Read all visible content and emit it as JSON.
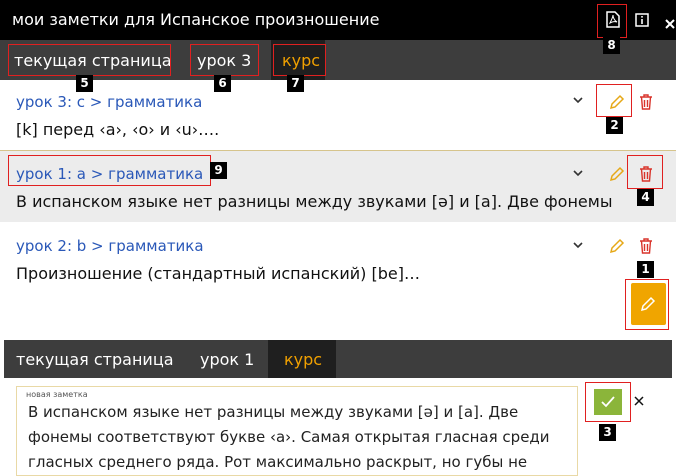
{
  "window": {
    "title": "мои заметки для Испанское произношение"
  },
  "title_icons": [
    "pdf-icon",
    "info-icon",
    "close-icon"
  ],
  "top_tabs": [
    {
      "label": "текущая страница",
      "active": false
    },
    {
      "label": "урок 3",
      "active": false
    },
    {
      "label": "курс",
      "active": true
    }
  ],
  "notes": [
    {
      "heading": "урок 3: c > грамматика",
      "text": "[k] перед ‹a›, ‹o› и ‹u›…."
    },
    {
      "heading": "урок 1: a > грамматика",
      "text": "В испанском языке нет разницы между звуками [ə] и [a]. Две фонемы"
    },
    {
      "heading": "урок 2: b > грамматика",
      "text": "Произношение (стандартный испанский) [be]…"
    }
  ],
  "bottom_tabs": [
    {
      "label": "текущая страница",
      "active": false
    },
    {
      "label": "урок 1",
      "active": false
    },
    {
      "label": "курс",
      "active": true
    }
  ],
  "editor": {
    "label": "новая заметка",
    "text": "В испанском языке нет разницы между звуками [ə] и [a]. Две фонемы соответствуют букве ‹a›. Самая открытая гласная среди гласных среднего ряда. Рот максимально раскрыт, но губы не"
  },
  "badges": [
    "1",
    "2",
    "3",
    "4",
    "5",
    "6",
    "7",
    "8",
    "9"
  ],
  "colors": {
    "accent": "#f0a000",
    "link": "#2a58b8",
    "annotation": "#e02020",
    "confirm": "#8bb53a",
    "trash": "#d9342b"
  }
}
